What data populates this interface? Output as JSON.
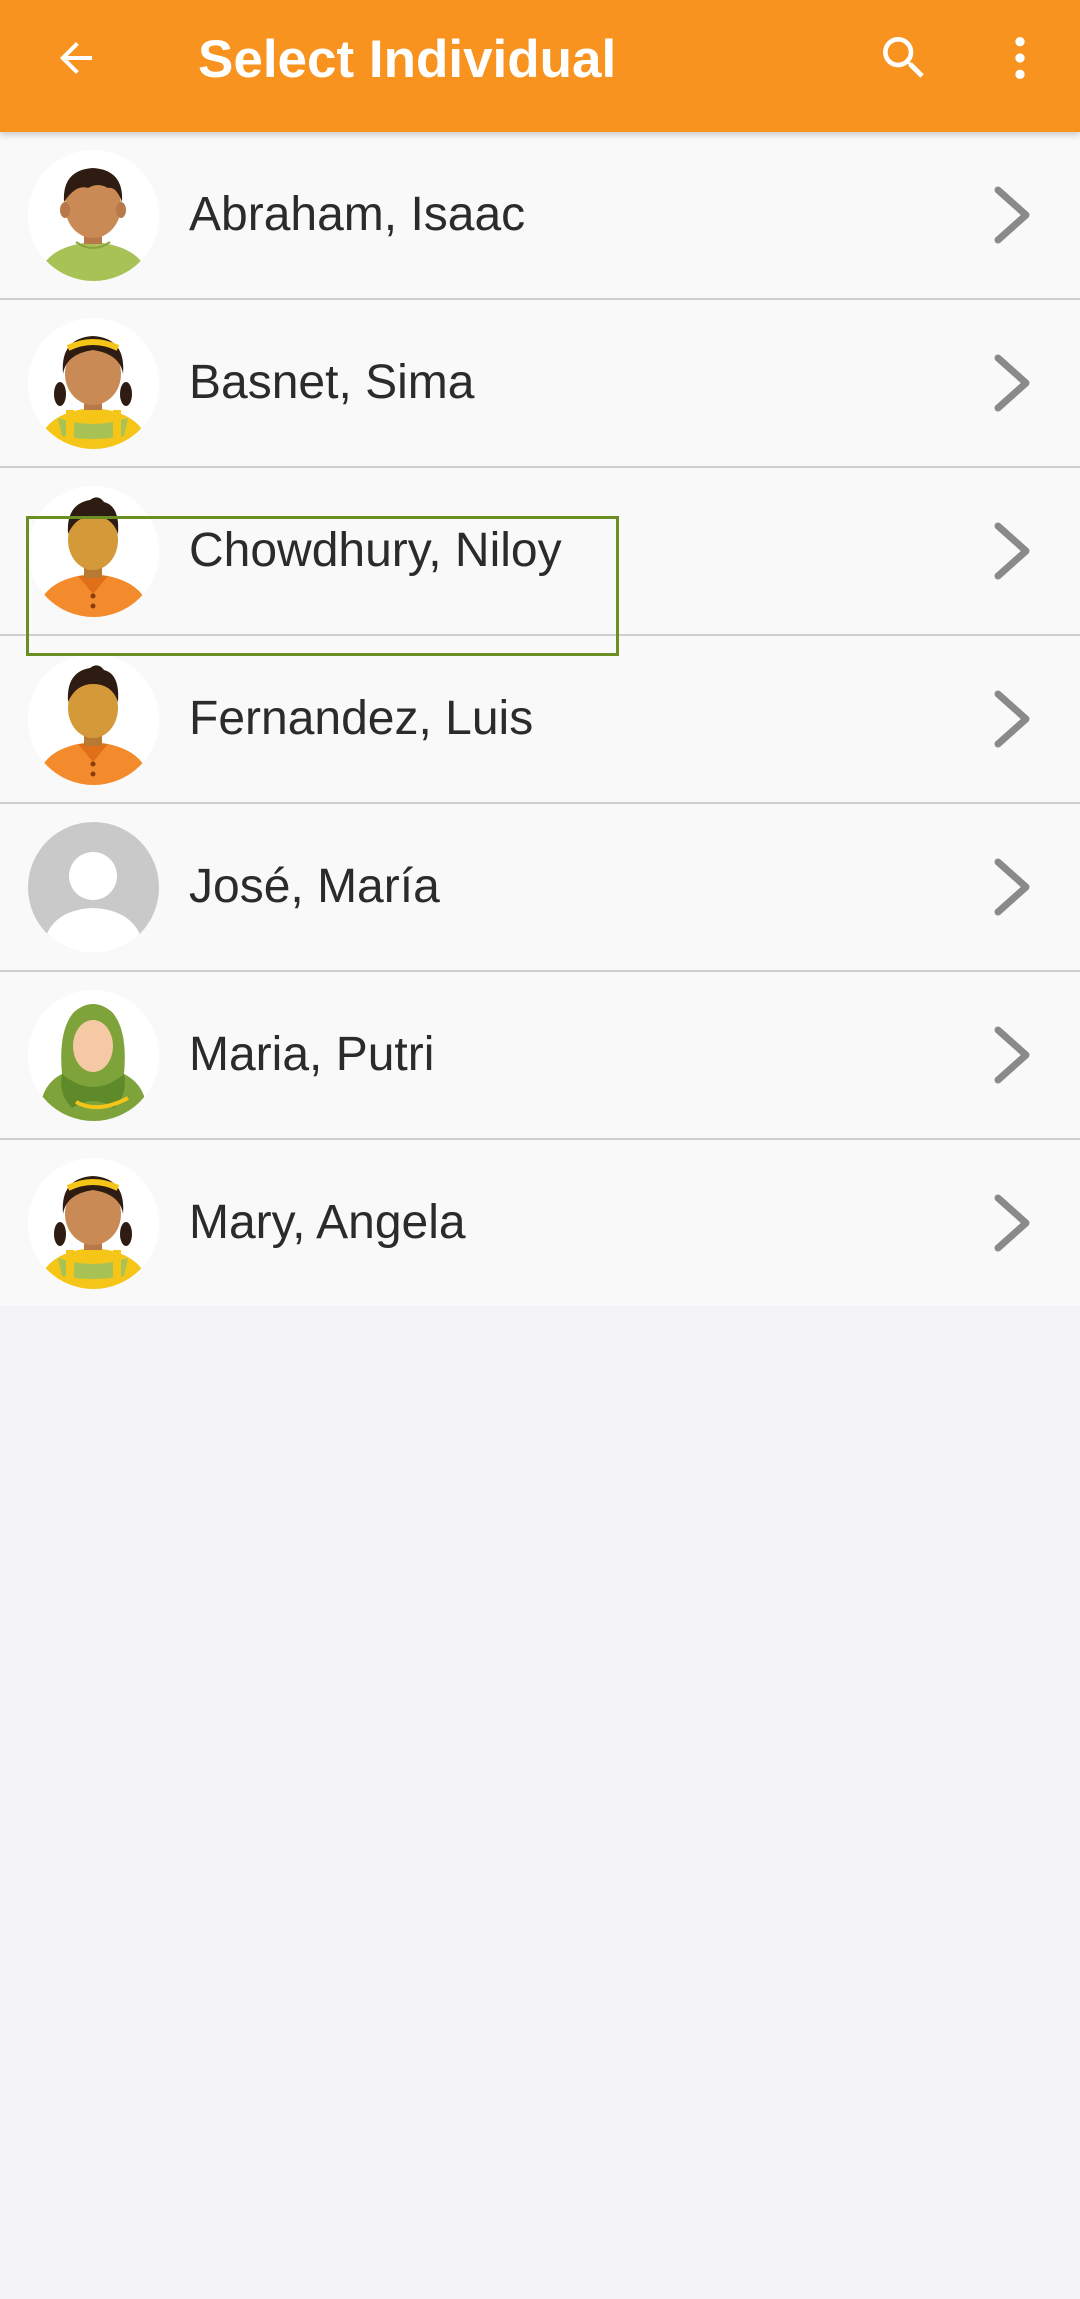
{
  "header": {
    "title": "Select Individual",
    "back_icon": "arrow-left-icon",
    "search_icon": "search-icon",
    "more_icon": "more-vertical-icon",
    "color": "#f7931e"
  },
  "individuals": [
    {
      "name": "Abraham, Isaac",
      "avatar": "boy-avatar"
    },
    {
      "name": "Basnet, Sima",
      "avatar": "girl-avatar"
    },
    {
      "name": "Chowdhury, Niloy",
      "avatar": "man-avatar"
    },
    {
      "name": "Fernandez, Luis",
      "avatar": "man-avatar",
      "selected": true
    },
    {
      "name": "José, María",
      "avatar": "default-avatar"
    },
    {
      "name": "Maria, Putri",
      "avatar": "hijab-woman-avatar"
    },
    {
      "name": "Mary, Angela",
      "avatar": "girl-avatar"
    }
  ],
  "selection_color": "#6b8e23"
}
